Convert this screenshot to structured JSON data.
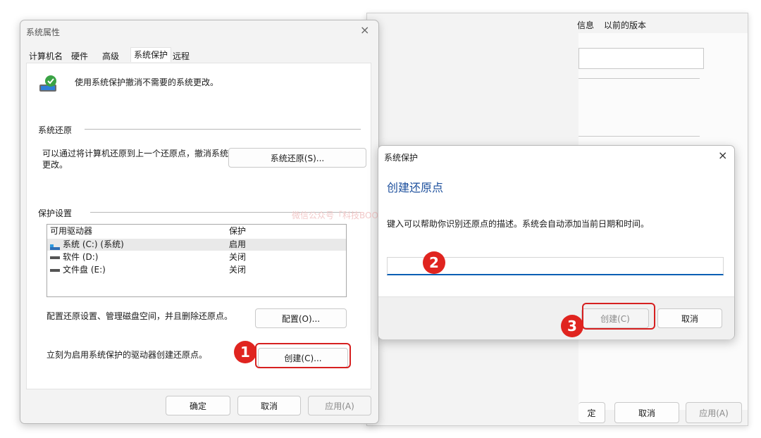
{
  "background_window": {
    "tabs": [
      "信息",
      "以前的版本"
    ],
    "buttons": {
      "ok_partial": "定",
      "cancel": "取消",
      "apply": "应用(A)"
    }
  },
  "system_properties": {
    "title": "系统属性",
    "tabs": [
      "计算机名",
      "硬件",
      "高级",
      "系统保护",
      "远程"
    ],
    "active_tab": "系统保护",
    "intro_text": "使用系统保护撤消不需要的系统更改。",
    "system_restore": {
      "group_label": "系统还原",
      "description": "可以通过将计算机还原到上一个还原点，撤消系统更改。",
      "button": "系统还原(S)..."
    },
    "protection_settings": {
      "group_label": "保护设置",
      "columns": [
        "可用驱动器",
        "保护"
      ],
      "drives": [
        {
          "name": "系统 (C:) (系统)",
          "protection": "启用",
          "icon": "system-drive-icon"
        },
        {
          "name": "软件 (D:)",
          "protection": "关闭",
          "icon": "drive-icon"
        },
        {
          "name": "文件盘 (E:)",
          "protection": "关闭",
          "icon": "drive-icon"
        }
      ],
      "configure_text": "配置还原设置、管理磁盘空间，并且删除还原点。",
      "configure_button": "配置(O)...",
      "create_text": "立刻为启用系统保护的驱动器创建还原点。",
      "create_button": "创建(C)..."
    },
    "footer": {
      "ok": "确定",
      "cancel": "取消",
      "apply": "应用(A)"
    }
  },
  "watermark": "微信公众号「科技BOOM」",
  "restore_dialog": {
    "title": "系统保护",
    "heading": "创建还原点",
    "instruction": "键入可以帮助你识别还原点的描述。系统会自动添加当前日期和时间。",
    "input_value": "",
    "create_button": "创建(C)",
    "cancel_button": "取消"
  },
  "annotations": [
    "1",
    "2",
    "3"
  ],
  "colors": {
    "accent": "#0a5fb4",
    "annotation_red": "#e0241f",
    "heading_blue": "#1c4f9c"
  }
}
